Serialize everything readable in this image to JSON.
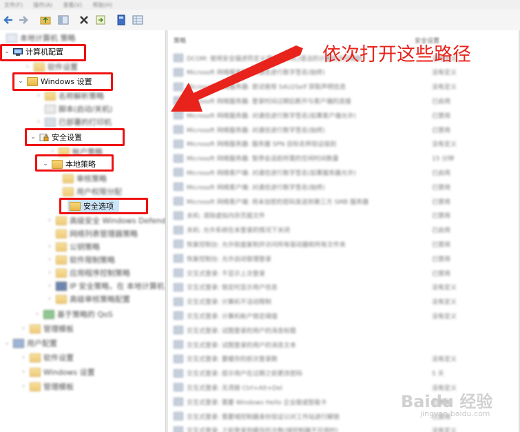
{
  "menu": {
    "items": [
      "文件(F)",
      "操作(A)",
      "查看(V)",
      "帮助(H)"
    ]
  },
  "tree": {
    "root_blurred": "本地计算机 策略",
    "computer_config": "计算机配置",
    "software_settings_blurred": "软件设置",
    "windows_settings": "Windows 设置",
    "name_resolution_blurred": "名称解析策略",
    "scripts_blurred": "脚本(启动/关机)",
    "printers_blurred": "已部署的打印机",
    "security_settings": "安全设置",
    "account_policy_blurred": "帐户策略",
    "local_policy": "本地策略",
    "audit_policy_blurred": "审核策略",
    "user_rights_blurred": "用户权限分配",
    "security_options": "安全选项",
    "firewall_blurred": "高级安全 Windows Defender 防火墙",
    "network_list_blurred": "网络列表管理器策略",
    "public_key_blurred": "公钥策略",
    "software_restriction_blurred": "软件限制策略",
    "app_control_blurred": "应用程序控制策略",
    "ip_security_blurred": "IP 安全策略，在 本地计算机",
    "advanced_audit_blurred": "高级审核策略配置",
    "qos_blurred": "基于策略的 QoS",
    "admin_templates_blurred": "管理模板",
    "user_config_blurred": "用户配置",
    "user_software_blurred": "软件设置",
    "user_windows_blurred": "Windows 设置",
    "user_admin_blurred": "管理模板"
  },
  "list": {
    "col_policy": "策略",
    "col_setting": "安全设置",
    "rows": [
      {
        "t": "DCOM: 使用安全描述符定义语言(SDDL)语法的计算机访问限制",
        "v": "没有定义"
      },
      {
        "t": "Microsoft 网络服务器: 对通信进行数字签名(始终)",
        "v": "没有定义"
      },
      {
        "t": "Microsoft 网络服务器: 尝试使用 S4U2Self 获取声明信息",
        "v": "没有定义"
      },
      {
        "t": "Microsoft 网络服务器: 登录时间过期后断开与客户端的连接",
        "v": "已启用"
      },
      {
        "t": "Microsoft 网络服务器: 对通信进行数字签名(如果客户端允许)",
        "v": "已禁用"
      },
      {
        "t": "Microsoft 网络服务器: 对通信进行数字签名(始终)",
        "v": "已禁用"
      },
      {
        "t": "Microsoft 网络服务器: 服务器 SPN 目标名称验证级别",
        "v": "没有定义"
      },
      {
        "t": "Microsoft 网络服务器: 暂停会话前所需的空闲时间数量",
        "v": "15 分钟"
      },
      {
        "t": "Microsoft 网络客户端: 对通信进行数字签名(如果服务器允许)",
        "v": "已启用"
      },
      {
        "t": "Microsoft 网络客户端: 对通信进行数字签名(始终)",
        "v": "已禁用"
      },
      {
        "t": "Microsoft 网络客户端: 将未加密的密码发送到第三方 SMB 服务器",
        "v": "已禁用"
      },
      {
        "t": "关机: 清除虚拟内存页面文件",
        "v": "已禁用"
      },
      {
        "t": "关机: 允许系统在未登录的情况下关闭",
        "v": "已启用"
      },
      {
        "t": "恢复控制台: 允许软盘复制并访问所有驱动器和所有文件夹",
        "v": "已禁用"
      },
      {
        "t": "恢复控制台: 允许自动管理登录",
        "v": "已禁用"
      },
      {
        "t": "交互式登录: 不显示上次登录",
        "v": "已禁用"
      },
      {
        "t": "交互式登录: 锁定时显示用户信息",
        "v": "没有定义"
      },
      {
        "t": "交互式登录: 计算机不活动限制",
        "v": "没有定义"
      },
      {
        "t": "交互式登录: 计算机帐户锁定阈值",
        "v": "没有定义"
      },
      {
        "t": "交互式登录: 试图登录的用户的消息标题",
        "v": ""
      },
      {
        "t": "交互式登录: 试图登录的用户的消息文本",
        "v": ""
      },
      {
        "t": "交互式登录: 要缓存的前次登录数",
        "v": "没有定义"
      },
      {
        "t": "交互式登录: 提示用户在过期之前更改密码",
        "v": "5 天"
      },
      {
        "t": "交互式登录: 无须按 Ctrl+Alt+Del",
        "v": "没有定义"
      },
      {
        "t": "交互式登录: 需要 Windows Hello 企业版或智能卡",
        "v": "已禁用"
      },
      {
        "t": "交互式登录: 需要域控制器身份验证以对工作站进行解锁",
        "v": "已禁用"
      },
      {
        "t": "交互式登录: 之前登录到缓存的次数(域控制器不可用时)",
        "v": "没有定义"
      }
    ]
  },
  "annotation": {
    "callout": "依次打开这些路径",
    "accent": "#e8231b"
  },
  "watermark": {
    "brand": "Baidu 经验",
    "url": "jingyan.baidu.com"
  }
}
